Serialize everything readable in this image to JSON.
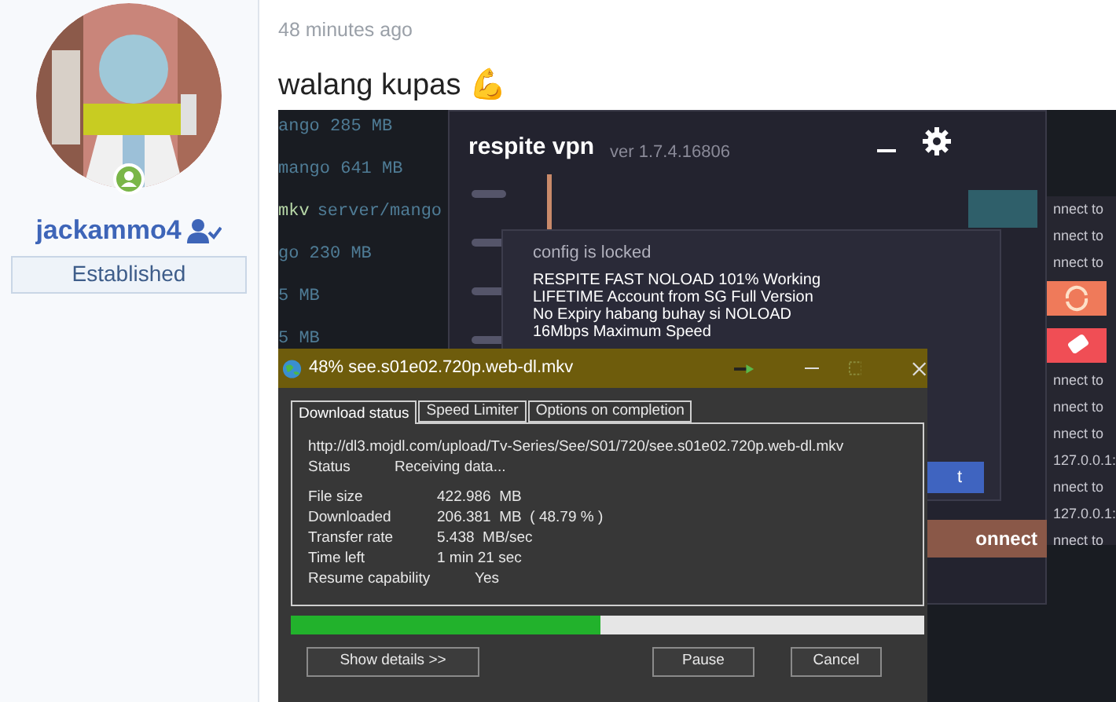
{
  "user": {
    "name": "jackammo4",
    "badge": "Established",
    "online": true
  },
  "post": {
    "time": "48 minutes ago",
    "message": "walang kupas 💪"
  },
  "attachment": {
    "terminal": {
      "lines": [
        {
          "kind": "plain",
          "text": "ango 285 MB"
        },
        {
          "kind": "plain",
          "text": "mango 641 MB"
        },
        {
          "kind": "command",
          "prefix": "mkv",
          "text": "server/mango"
        },
        {
          "kind": "plain",
          "text": "go 230 MB"
        },
        {
          "kind": "plain",
          "text": "5 MB"
        },
        {
          "kind": "plain",
          "text": "5 MB"
        }
      ]
    },
    "vpn_window": {
      "title": "respite vpn",
      "version": "ver 1.7.4.16806",
      "dialog": {
        "heading": "config is locked",
        "lines": [
          "RESPITE FAST NOLOAD 101% Working",
          "LIFETIME Account from SG Full Version",
          "No Expiry habang buhay si NOLOAD",
          "16Mbps Maximum Speed"
        ]
      },
      "button_fragment": "t",
      "connect_fragment": "onnect"
    },
    "log_panel": {
      "lines": [
        "nnect to",
        "nnect to",
        "nnect to",
        "nnect to",
        "nnect to",
        "nnect to",
        "127.0.0.1:",
        "nnect to",
        "127.0.0.1:",
        "nnect to"
      ]
    },
    "download_window": {
      "title": "48% see.s01e02.720p.web-dl.mkv",
      "tabs": [
        {
          "label": "Download status",
          "selected": true
        },
        {
          "label": "Speed Limiter",
          "selected": false
        },
        {
          "label": "Options on completion",
          "selected": false
        }
      ],
      "url": "http://dl3.mojdl.com/upload/Tv-Series/See/S01/720/see.s01e02.720p.web-dl.mkv",
      "status": {
        "label": "Status",
        "value": "Receiving data..."
      },
      "details": [
        {
          "label": "File size",
          "value": "422.986  MB"
        },
        {
          "label": "Downloaded",
          "value": "206.381  MB  ( 48.79 % )"
        },
        {
          "label": "Transfer rate",
          "value": "5.438  MB/sec"
        },
        {
          "label": "Time left",
          "value": "1 min 21 sec"
        },
        {
          "label": "Resume capability",
          "value": "Yes"
        }
      ],
      "progress": {
        "level": 0.4879
      },
      "buttons": {
        "details": "Show details >>",
        "pause": "Pause",
        "cancel": "Cancel"
      }
    }
  }
}
